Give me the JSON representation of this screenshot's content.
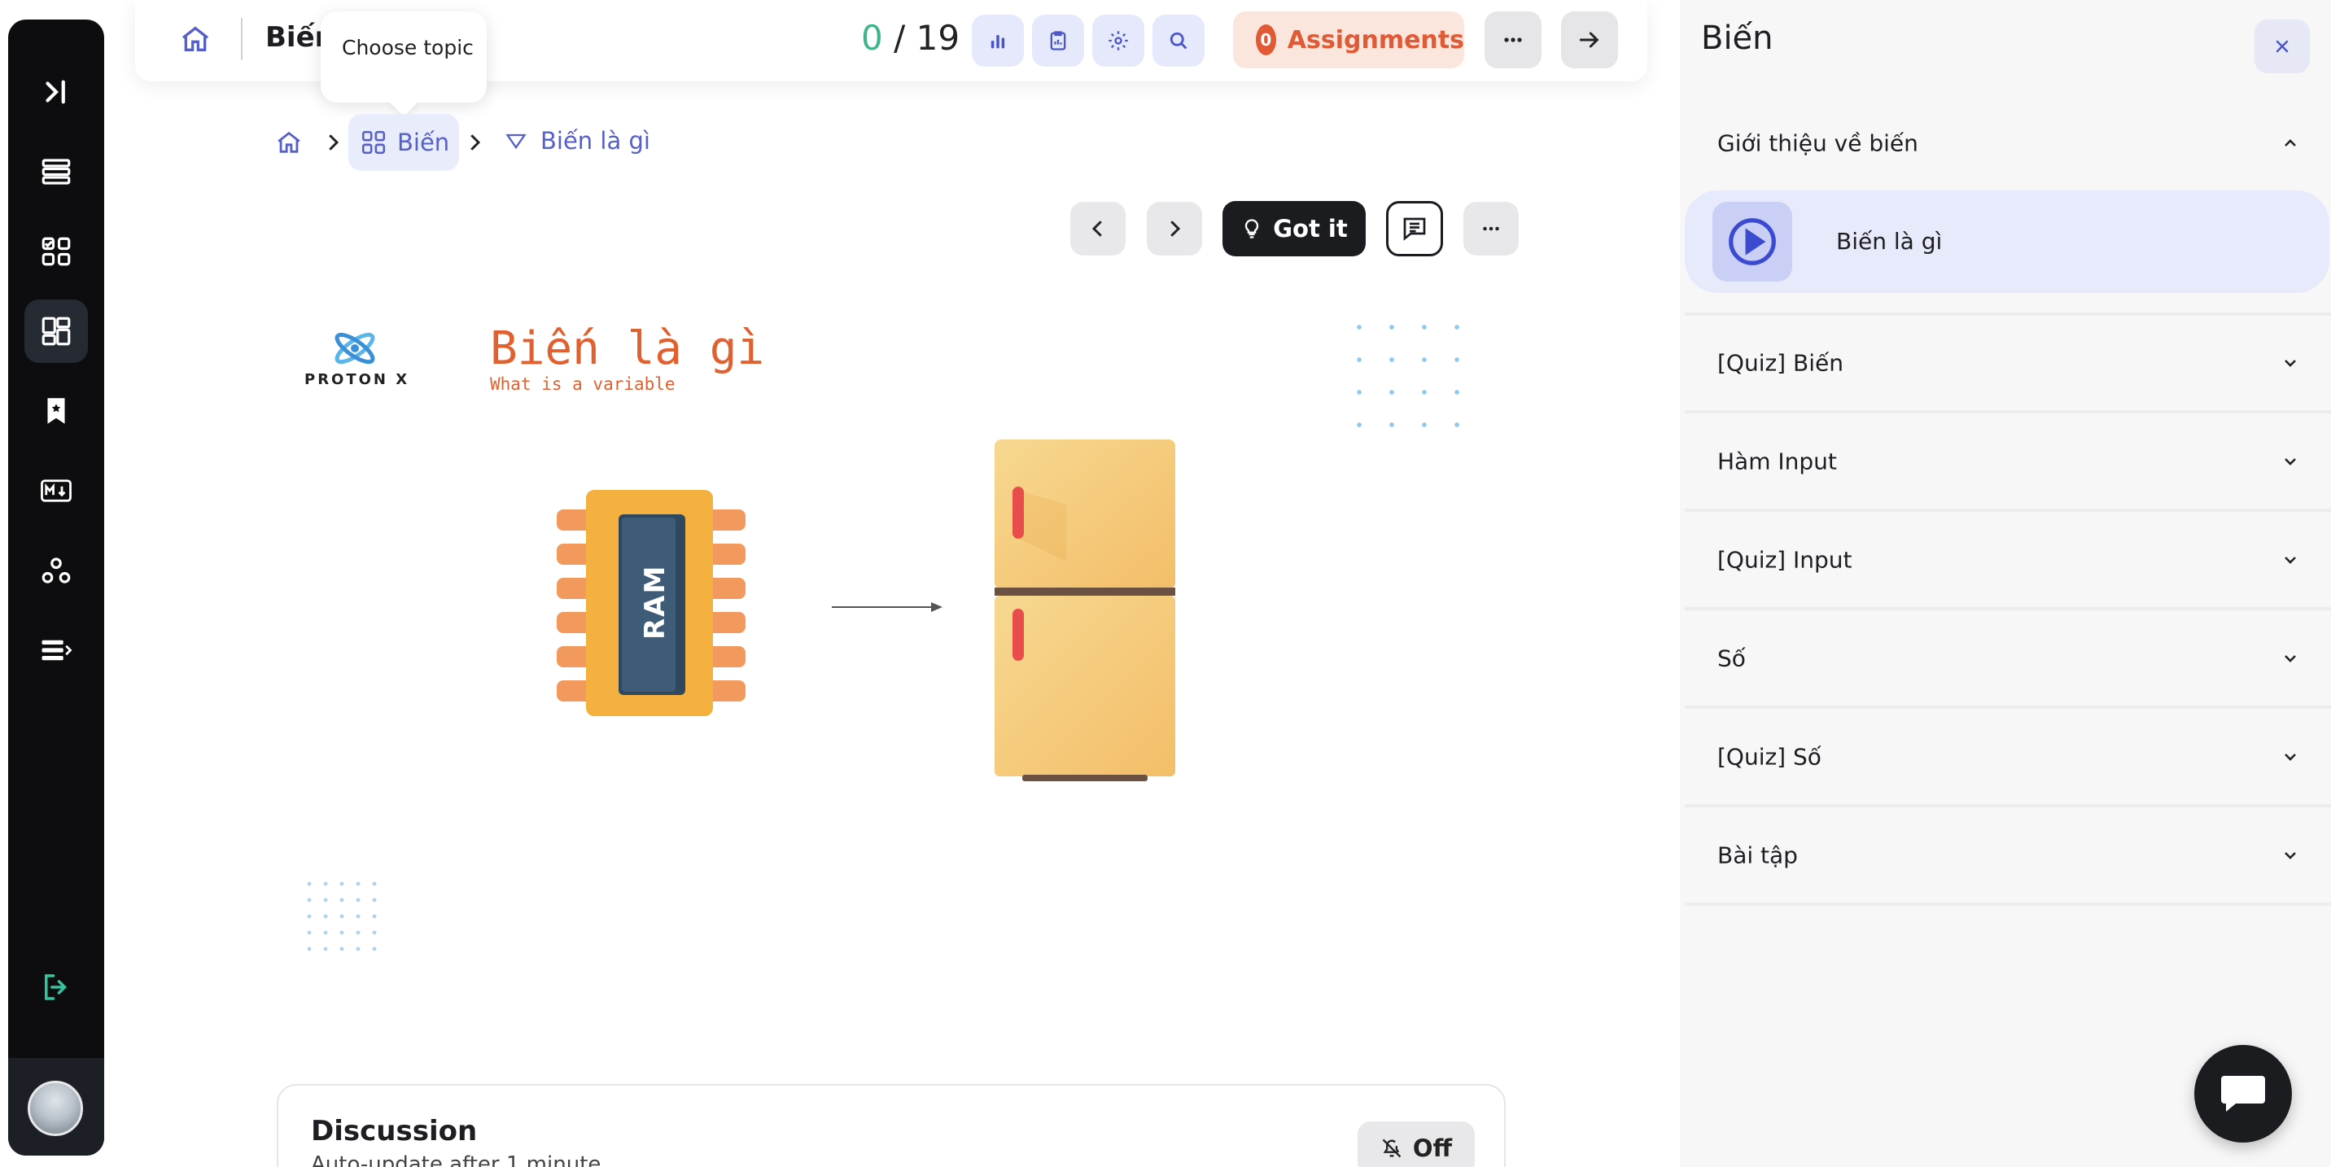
{
  "topbar": {
    "title": "Biến",
    "progress_done": "0",
    "progress_sep": " / ",
    "progress_total": "19",
    "assignments_count": "0",
    "assignments_label": "Assignments",
    "icons": [
      "chart-icon",
      "clipboard-icon",
      "settings-icon",
      "search-icon"
    ]
  },
  "tooltip": {
    "text": "Choose topic"
  },
  "breadcrumb": {
    "topic": "Biến",
    "lesson": "Biến là gì"
  },
  "controls": {
    "got_it_label": "Got it"
  },
  "slide": {
    "logo_text": "PROTON X",
    "title": "Biến là gì",
    "subtitle": "What is a variable",
    "chip_label": "RAM"
  },
  "discussion": {
    "title": "Discussion",
    "subtitle": "Auto-update after 1 minute",
    "toggle_label": "Off"
  },
  "panel": {
    "title": "Biến",
    "sections": [
      {
        "label": "Giới thiệu về biến",
        "expanded": true,
        "items": [
          {
            "label": "Biến là gì"
          }
        ]
      },
      {
        "label": "[Quiz] Biến",
        "expanded": false
      },
      {
        "label": "Hàm Input",
        "expanded": false
      },
      {
        "label": "[Quiz] Input",
        "expanded": false
      },
      {
        "label": "Số",
        "expanded": false
      },
      {
        "label": "[Quiz] Số",
        "expanded": false
      },
      {
        "label": "Bài tập",
        "expanded": false
      }
    ]
  },
  "colors": {
    "accent": "#5560c8",
    "progress_done": "#3cb58c",
    "assignments": "#e05a36",
    "slide_title": "#e0612f",
    "rail_bg": "#0d0d10"
  }
}
